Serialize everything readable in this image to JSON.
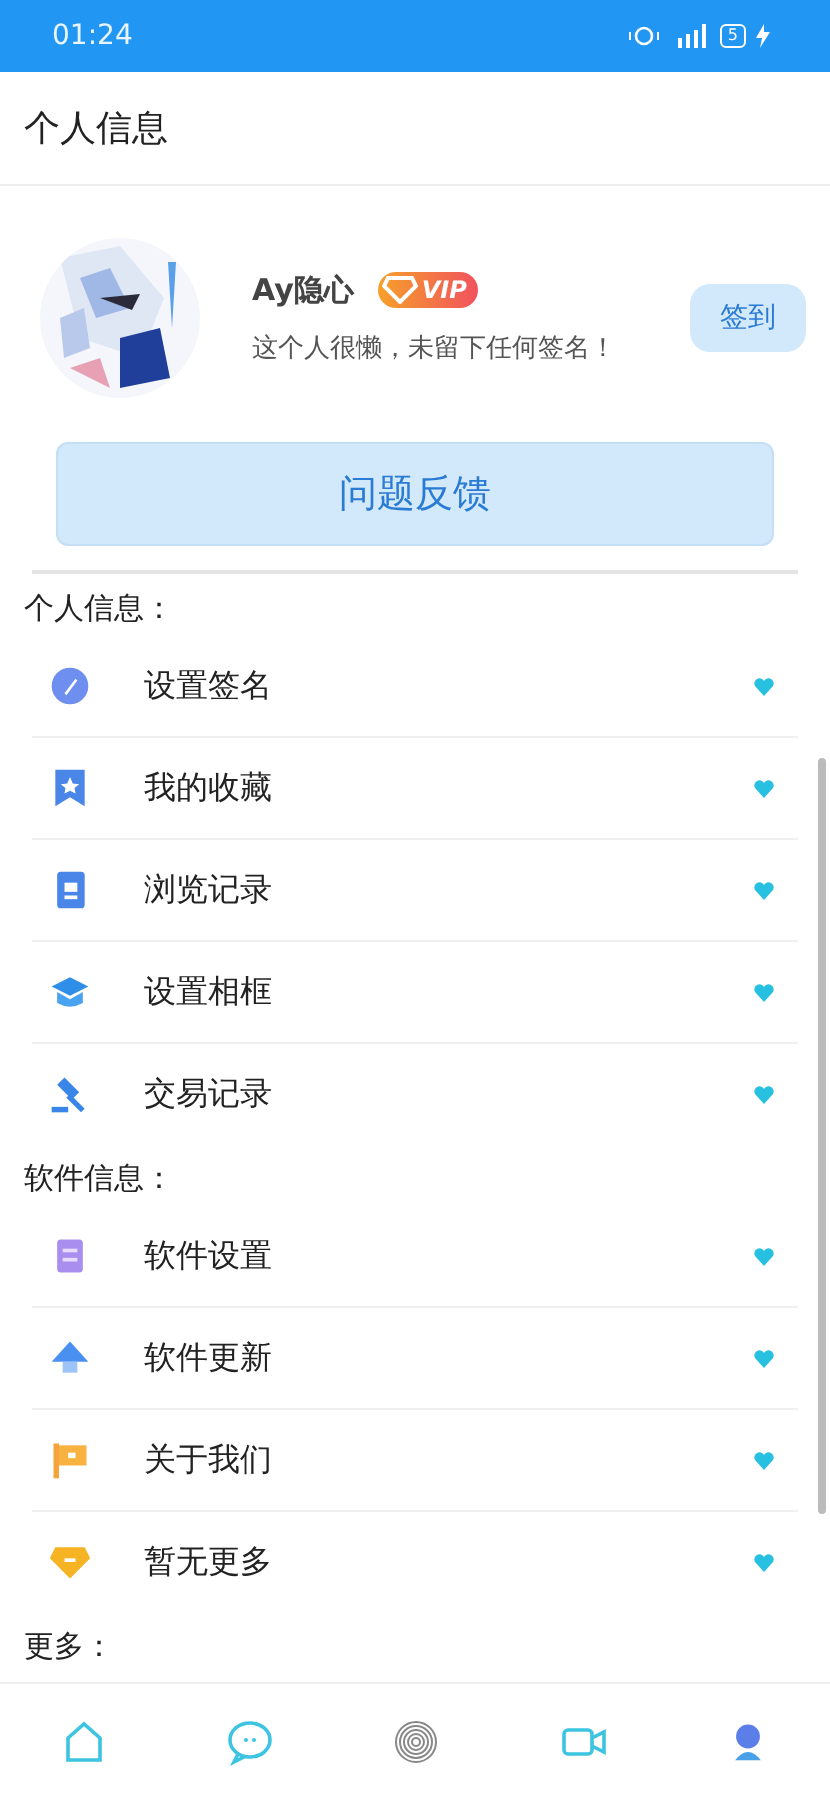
{
  "status_bar": {
    "time": "01:24",
    "battery": "5"
  },
  "header": {
    "title": "个人信息"
  },
  "profile": {
    "name": "Ay隐心",
    "vip": "VIP",
    "signature": "这个人很懒，未留下任何签名！",
    "checkin_button": "签到"
  },
  "feedback_button": "问题反馈",
  "sections": [
    {
      "title": "个人信息：",
      "items": [
        {
          "label": "设置签名",
          "kind": "pen"
        },
        {
          "label": "我的收藏",
          "kind": "bookmark"
        },
        {
          "label": "浏览记录",
          "kind": "document"
        },
        {
          "label": "设置相框",
          "kind": "cap"
        },
        {
          "label": "交易记录",
          "kind": "gavel"
        }
      ]
    },
    {
      "title": "软件信息：",
      "items": [
        {
          "label": "软件设置",
          "kind": "notepad"
        },
        {
          "label": "软件更新",
          "kind": "uparrow"
        },
        {
          "label": "关于我们",
          "kind": "flag"
        },
        {
          "label": "暂无更多",
          "kind": "diamond"
        }
      ]
    },
    {
      "title": "更多："
    }
  ],
  "bottom_nav": [
    {
      "kind": "home",
      "selected": false
    },
    {
      "kind": "chat",
      "selected": false
    },
    {
      "kind": "fingerprint",
      "selected": false
    },
    {
      "kind": "video",
      "selected": false
    },
    {
      "kind": "person",
      "selected": true
    }
  ]
}
